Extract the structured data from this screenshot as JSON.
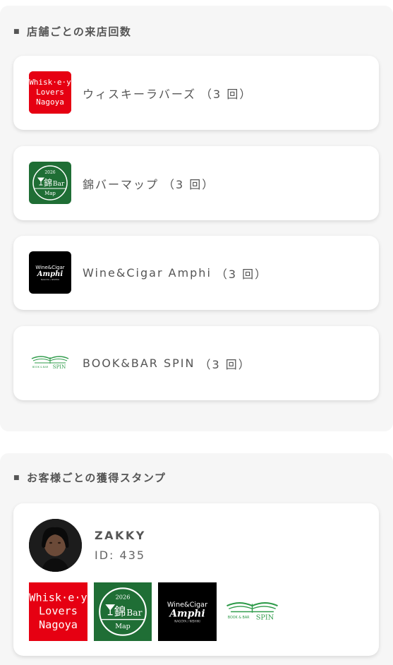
{
  "visits": {
    "title": "店舗ごとの来店回数",
    "shops": [
      {
        "name": "ウィスキーラバーズ",
        "count_label": "（3 回）",
        "logo_icon": "whiskey-lovers-nagoya-logo"
      },
      {
        "name": "錦バーマップ",
        "count_label": "（3 回）",
        "logo_icon": "nishiki-bar-map-logo"
      },
      {
        "name": "Wine&Cigar Amphi",
        "count_label": "（3 回）",
        "logo_icon": "wine-cigar-amphi-logo"
      },
      {
        "name": "BOOK&BAR SPIN",
        "count_label": "（3 回）",
        "logo_icon": "book-bar-spin-logo"
      }
    ]
  },
  "stamps": {
    "title": "お客様ごとの獲得スタンプ",
    "customer": {
      "name": "ZAKKY",
      "id_label": "ID: 435"
    }
  },
  "logo_text": {
    "whiskey": [
      "Whisk·e·y",
      "Lovers",
      "Nagoya"
    ],
    "nishiki": {
      "year": "2026",
      "kanji": "錦",
      "bar": "Bar",
      "map": "Map"
    },
    "amphi": {
      "top": "Wine&Cigar",
      "main": "Amphi",
      "sub": "NAGOYA / NISHIKI"
    },
    "spin": {
      "left": "BOOK & BAR",
      "right": "SPIN"
    }
  },
  "colors": {
    "whiskey_red": "#e60012",
    "nishiki_green": "#1f6e35",
    "spin_green": "#2f9b4a"
  }
}
